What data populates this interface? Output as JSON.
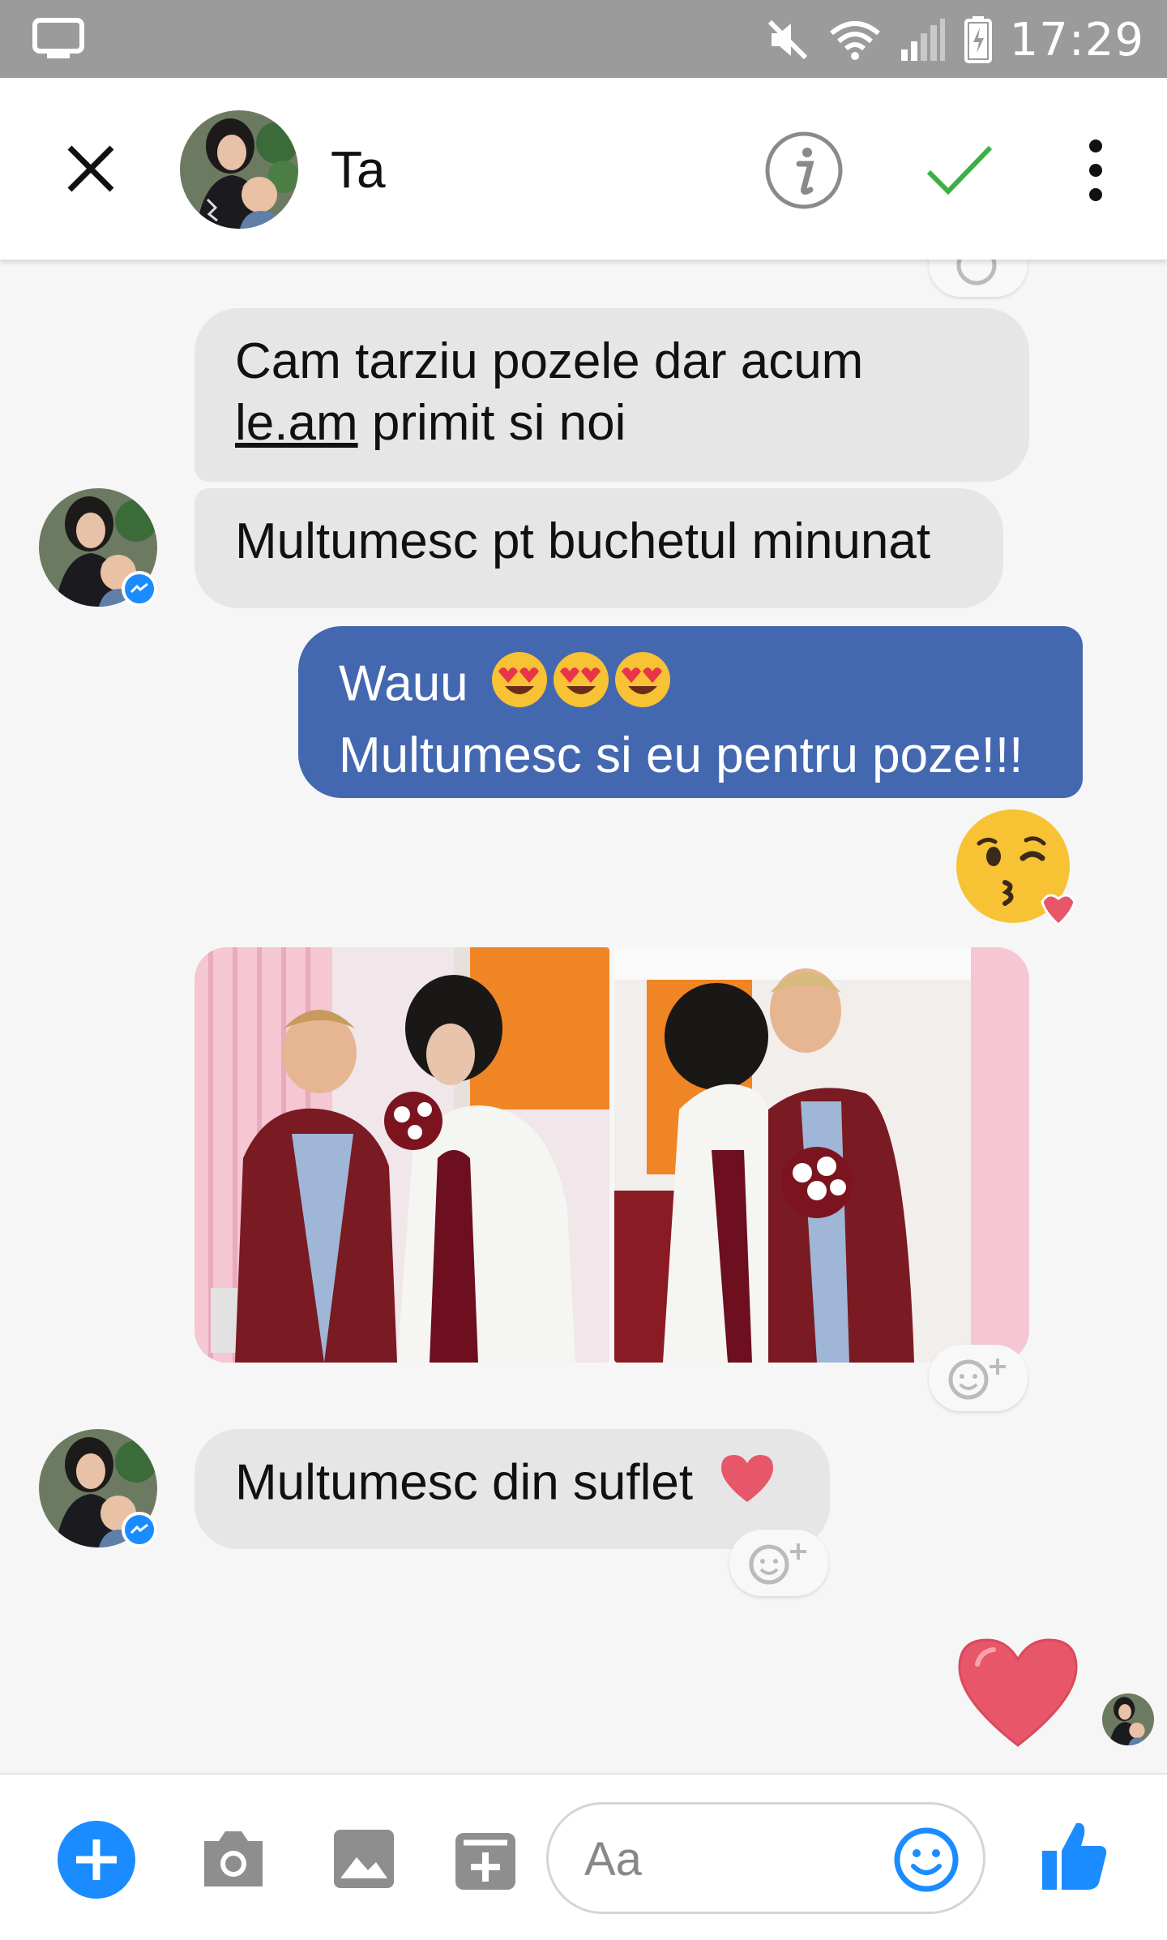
{
  "status_bar": {
    "time": "17:29"
  },
  "header": {
    "contact_name": "Ta"
  },
  "messages": {
    "m1_line1": "Cam tarziu pozele dar acum",
    "m1_line2_link": "le.am",
    "m1_line2_rest": " primit si noi",
    "m2": "Multumesc pt buchetul minunat",
    "m3_line1": "Wauu",
    "m3_line2": "Multumesc si eu pentru poze!!!",
    "m5": "Multumesc din suflet"
  },
  "composer": {
    "placeholder": "Aa"
  },
  "colors": {
    "status_bar": "#9b9b9b",
    "outgoing_bubble": "#4468b0",
    "incoming_bubble": "#e6e6e6",
    "messenger_blue": "#1a8cff",
    "check_green": "#3cb043",
    "heart_red": "#e8566a"
  },
  "icons": [
    "monitor-icon",
    "mute-icon",
    "wifi-icon",
    "signal-icon",
    "battery-icon",
    "close-icon",
    "info-icon",
    "check-icon",
    "more-icon",
    "heart-eyes-emoji",
    "kiss-emoji",
    "heart-emoji",
    "add-reaction-icon",
    "plus-icon",
    "camera-icon",
    "gallery-icon",
    "sticker-icon",
    "emoji-icon",
    "thumbs-up-icon"
  ]
}
